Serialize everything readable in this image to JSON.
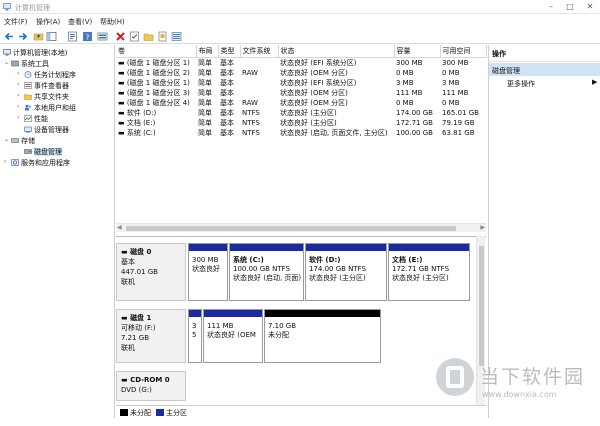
{
  "window": {
    "title": "计算机管理"
  },
  "menu": [
    {
      "label": "文件(F)"
    },
    {
      "label": "操作(A)"
    },
    {
      "label": "查看(V)"
    },
    {
      "label": "帮助(H)"
    }
  ],
  "tree": {
    "root": "计算机管理(本地)",
    "system_tools": "系统工具",
    "task_scheduler": "任务计划程序",
    "event_viewer": "事件查看器",
    "shared_folders": "共享文件夹",
    "local_users": "本地用户和组",
    "performance": "性能",
    "device_manager": "设备管理器",
    "storage": "存储",
    "disk_management": "磁盘管理",
    "services": "服务和应用程序"
  },
  "volume_table": {
    "headers": [
      "卷",
      "布局",
      "类型",
      "文件系统",
      "状态",
      "容量",
      "可用空间"
    ],
    "rows": [
      [
        "(磁盘 1 磁盘分区 1)",
        "简单",
        "基本",
        "",
        "状态良好 (EFI 系统分区)",
        "300 MB",
        "300 MB"
      ],
      [
        "(磁盘 1 磁盘分区 2)",
        "简单",
        "基本",
        "RAW",
        "状态良好 (OEM 分区)",
        "0 MB",
        "0 MB"
      ],
      [
        "(磁盘 1 磁盘分区 1)",
        "简单",
        "基本",
        "",
        "状态良好 (EFI 系统分区)",
        "3 MB",
        "3 MB"
      ],
      [
        "(磁盘 1 磁盘分区 3)",
        "简单",
        "基本",
        "",
        "状态良好 (OEM 分区)",
        "111 MB",
        "111 MB"
      ],
      [
        "(磁盘 1 磁盘分区 4)",
        "简单",
        "基本",
        "RAW",
        "状态良好 (OEM 分区)",
        "0 MB",
        "0 MB"
      ],
      [
        "软件 (D:)",
        "简单",
        "基本",
        "NTFS",
        "状态良好 (主分区)",
        "174.00 GB",
        "165.01 GB"
      ],
      [
        "文档 (E:)",
        "简单",
        "基本",
        "NTFS",
        "状态良好 (主分区)",
        "172.71 GB",
        "79.19 GB"
      ],
      [
        "系统 (C:)",
        "简单",
        "基本",
        "NTFS",
        "状态良好 (启动, 页面文件, 主分区)",
        "100.00 GB",
        "63.81 GB"
      ]
    ]
  },
  "disks": {
    "disk0": {
      "name": "磁盘 0",
      "type": "基本",
      "size": "447.01 GB",
      "status": "联机",
      "partitions": [
        {
          "line1": "300 MB",
          "line2": "状态良好"
        },
        {
          "line1": "系统 (C:)",
          "line2": "100.00 GB NTFS",
          "line3": "状态良好 (启动, 页面)"
        },
        {
          "line1": "软件 (D:)",
          "line2": "174.00 GB NTFS",
          "line3": "状态良好 (主分区)"
        },
        {
          "line1": "文档 (E:)",
          "line2": "172.71 GB NTFS",
          "line3": "状态良好 (主分区)"
        }
      ]
    },
    "disk1": {
      "name": "磁盘 1",
      "type": "可移动 (F:)",
      "size": "7.21 GB",
      "status": "联机",
      "partitions": [
        {
          "line1": "3",
          "line2": "5"
        },
        {
          "line1": "111 MB",
          "line2": "状态良好 (OEM"
        },
        {
          "line1": "7.10 GB",
          "line2": "未分配"
        }
      ]
    },
    "cdrom0": {
      "name": "CD-ROM 0",
      "drive": "DVD (G:)"
    }
  },
  "legend": {
    "unallocated": "未分配",
    "primary": "主分区"
  },
  "actions": {
    "header": "操作",
    "section": "磁盘管理",
    "more": "更多操作"
  },
  "watermark": {
    "text": "当下软件园",
    "url": "www.downxia.com"
  },
  "colors": {
    "primary_partition": "#1b2aa0",
    "unallocated": "#000000",
    "selection": "#cce4f7",
    "actions_section": "#cfe3f4"
  }
}
